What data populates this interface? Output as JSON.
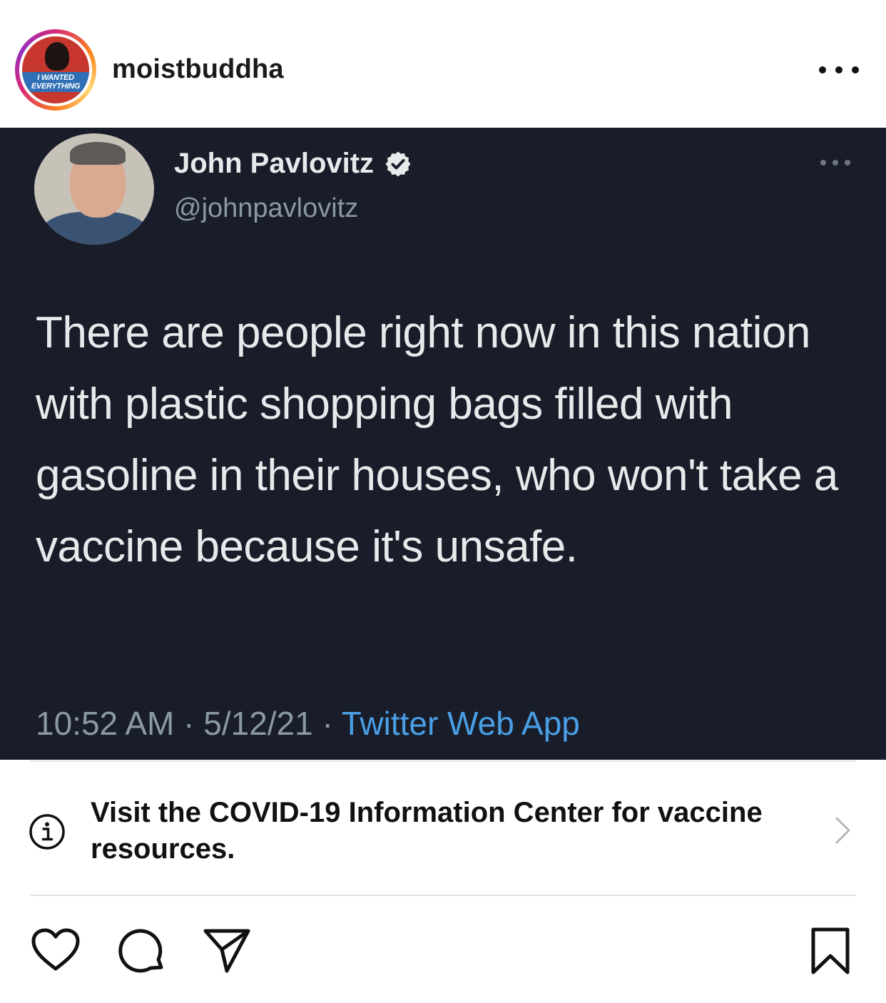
{
  "post": {
    "username": "moistbuddha",
    "avatar_badge": "I WANTED EVERYTHING",
    "more_icon": "more-horizontal-icon"
  },
  "tweet": {
    "name": "John Pavlovitz",
    "handle": "@johnpavlovitz",
    "verified_icon": "verified-badge-icon",
    "text": "There are people right now in this nation with plastic shopping bags filled with gasoline in their houses, who won't take a vaccine because it's unsafe.",
    "time": "10:52 AM",
    "date": "5/12/21",
    "source": "Twitter Web App",
    "separator": " · ",
    "colors": {
      "background": "#191d2a",
      "link": "#4a9fe6"
    }
  },
  "covid_banner": {
    "text": "Visit the COVID-19 Information Center for vaccine resources.",
    "icon": "info-icon",
    "chevron": "chevron-right-icon"
  },
  "actions": {
    "like": "heart-icon",
    "comment": "comment-icon",
    "share": "paper-plane-icon",
    "save": "bookmark-icon"
  }
}
